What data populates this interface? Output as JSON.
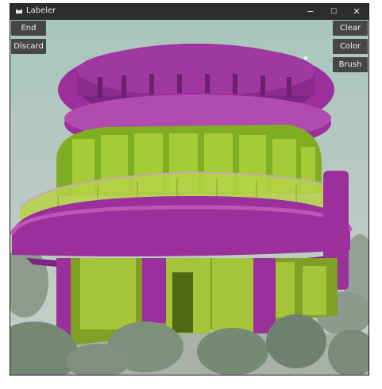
{
  "window": {
    "title": "Labeler",
    "icon": "cat-icon",
    "controls": {
      "minimize": "−",
      "maximize": "☐",
      "close": "✕"
    }
  },
  "toolbar_left": {
    "end_label": "End",
    "discard_label": "Discard"
  },
  "toolbar_right": {
    "clear_label": "Clear",
    "color_label": "Color",
    "brush_label": "Brush"
  },
  "colors": {
    "mask_purple": "#9b2f9c",
    "mask_green": "#8fc21f",
    "button_bg": "#464646",
    "titlebar_bg": "#2d2d2d"
  }
}
